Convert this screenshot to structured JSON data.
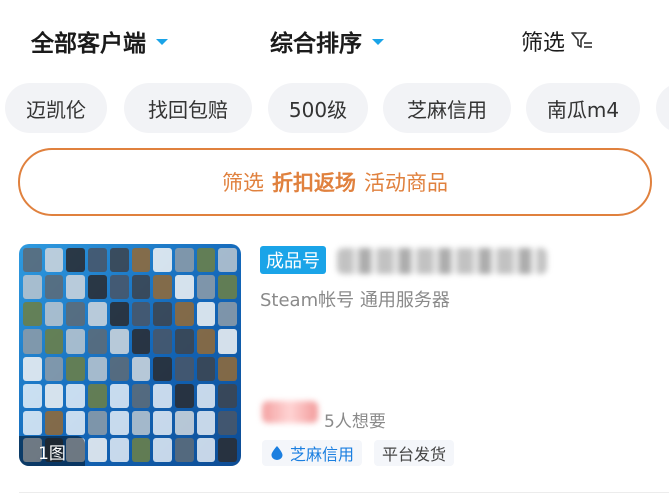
{
  "top_bar": {
    "client_filter": "全部客户端",
    "sort": "综合排序",
    "filter": "筛选"
  },
  "chips": [
    "迈凯伦",
    "找回包赔",
    "500级",
    "芝麻信用",
    "南瓜m4"
  ],
  "promo": {
    "prefix": "筛选",
    "highlight": "折扣返场",
    "suffix": "活动商品"
  },
  "listing": {
    "tag": "成品号",
    "subtitle": "Steam帐号  通用服务器",
    "wants": "5人想要",
    "image_count": "1图",
    "badges": [
      "芝麻信用",
      "平台发货"
    ]
  },
  "colors": {
    "accent_blue": "#1aa4e8",
    "promo_orange": "#e0813e",
    "chip_bg": "#f2f3f6"
  }
}
